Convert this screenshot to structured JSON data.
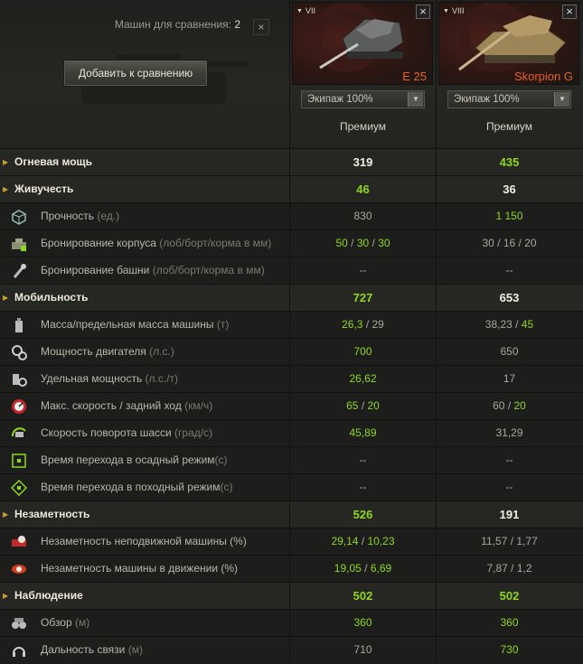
{
  "compare": {
    "label": "Машин для сравнения:",
    "count": "2",
    "close": "×",
    "add_button": "Добавить к сравнению"
  },
  "tanks": [
    {
      "tier": "VII",
      "name": "E 25",
      "crew": "Экипаж 100%",
      "type": "Премиум"
    },
    {
      "tier": "VIII",
      "name": "Skorpion G",
      "crew": "Экипаж 100%",
      "type": "Премиум"
    }
  ],
  "icons_close": "×",
  "colors": {
    "better": "#8fd81f",
    "neutral": "#a9a79b",
    "tank_name": "#e8602a"
  },
  "rows": [
    {
      "kind": "cat",
      "label": "Огневая мощь",
      "unit": "",
      "v1": [
        [
          "319",
          "w"
        ]
      ],
      "v2": [
        [
          "435",
          "g"
        ]
      ]
    },
    {
      "kind": "cat",
      "label": "Живучесть",
      "unit": "",
      "v1": [
        [
          "46",
          "g"
        ]
      ],
      "v2": [
        [
          "36",
          "w"
        ]
      ]
    },
    {
      "kind": "sub",
      "icon": "hitpoints-icon",
      "label": "Прочность",
      "unit": " (ед.)",
      "v1": [
        [
          "830",
          "n"
        ]
      ],
      "v2": [
        [
          "1 150",
          "g"
        ]
      ]
    },
    {
      "kind": "sub",
      "icon": "hull-armor-icon",
      "label": "Бронирование корпуса",
      "unit": " (лоб/борт/корма в мм)",
      "v1": [
        [
          "50",
          "g"
        ],
        [
          "30",
          "g"
        ],
        [
          "30",
          "g"
        ]
      ],
      "v2": [
        [
          "30",
          "n"
        ],
        [
          "16",
          "n"
        ],
        [
          "20",
          "n"
        ]
      ]
    },
    {
      "kind": "sub",
      "icon": "turret-armor-icon",
      "label": "Бронирование башни",
      "unit": " (лоб/борт/корма в мм)",
      "v1": [
        [
          "--",
          "n"
        ]
      ],
      "v2": [
        [
          "--",
          "n"
        ]
      ]
    },
    {
      "kind": "cat",
      "label": "Мобильность",
      "unit": "",
      "v1": [
        [
          "727",
          "g"
        ]
      ],
      "v2": [
        [
          "653",
          "w"
        ]
      ]
    },
    {
      "kind": "sub",
      "icon": "weight-icon",
      "label": "Масса/предельная масса машины",
      "unit": " (т)",
      "v1": [
        [
          "26,3",
          "g"
        ],
        [
          "29",
          "n"
        ]
      ],
      "v2": [
        [
          "38,23",
          "n"
        ],
        [
          "45",
          "g"
        ]
      ]
    },
    {
      "kind": "sub",
      "icon": "engine-power-icon",
      "label": "Мощность двигателя",
      "unit": " (л.с.)",
      "v1": [
        [
          "700",
          "g"
        ]
      ],
      "v2": [
        [
          "650",
          "n"
        ]
      ]
    },
    {
      "kind": "sub",
      "icon": "specific-power-icon",
      "label": "Удельная мощность",
      "unit": " (л.с./т)",
      "v1": [
        [
          "26,62",
          "g"
        ]
      ],
      "v2": [
        [
          "17",
          "n"
        ]
      ]
    },
    {
      "kind": "sub",
      "icon": "speed-icon",
      "label": "Макс. скорость / задний ход",
      "unit": " (км/ч)",
      "v1": [
        [
          "65",
          "g"
        ],
        [
          "20",
          "g"
        ]
      ],
      "v2": [
        [
          "60",
          "n"
        ],
        [
          "20",
          "g"
        ]
      ]
    },
    {
      "kind": "sub",
      "icon": "traverse-icon",
      "label": "Скорость поворота шасси",
      "unit": " (град/с)",
      "v1": [
        [
          "45,89",
          "g"
        ]
      ],
      "v2": [
        [
          "31,29",
          "n"
        ]
      ]
    },
    {
      "kind": "sub",
      "icon": "siege-mode-icon",
      "label": "Время перехода в осадный режим",
      "unit": "(с)",
      "v1": [
        [
          "--",
          "n"
        ]
      ],
      "v2": [
        [
          "--",
          "n"
        ]
      ]
    },
    {
      "kind": "sub",
      "icon": "travel-mode-icon",
      "label": "Время перехода в походный режим",
      "unit": "(с)",
      "v1": [
        [
          "--",
          "n"
        ]
      ],
      "v2": [
        [
          "--",
          "n"
        ]
      ]
    },
    {
      "kind": "cat",
      "label": "Незаметность",
      "unit": "",
      "v1": [
        [
          "526",
          "g"
        ]
      ],
      "v2": [
        [
          "191",
          "w"
        ]
      ]
    },
    {
      "kind": "sub",
      "icon": "camo-stationary-icon",
      "label": "Незаметность неподвижной машины (%)",
      "unit": "",
      "v1": [
        [
          "29,14",
          "g"
        ],
        [
          "10,23",
          "g"
        ]
      ],
      "v2": [
        [
          "11,57",
          "n"
        ],
        [
          "1,77",
          "n"
        ]
      ]
    },
    {
      "kind": "sub",
      "icon": "camo-moving-icon",
      "label": "Незаметность машины в движении (%)",
      "unit": "",
      "v1": [
        [
          "19,05",
          "g"
        ],
        [
          "6,69",
          "g"
        ]
      ],
      "v2": [
        [
          "7,87",
          "n"
        ],
        [
          "1,2",
          "n"
        ]
      ]
    },
    {
      "kind": "cat",
      "label": "Наблюдение",
      "unit": "",
      "v1": [
        [
          "502",
          "g"
        ]
      ],
      "v2": [
        [
          "502",
          "g"
        ]
      ]
    },
    {
      "kind": "sub",
      "icon": "view-range-icon",
      "label": "Обзор",
      "unit": " (м)",
      "v1": [
        [
          "360",
          "g"
        ]
      ],
      "v2": [
        [
          "360",
          "g"
        ]
      ]
    },
    {
      "kind": "sub",
      "icon": "radio-range-icon",
      "label": "Дальность связи",
      "unit": " (м)",
      "v1": [
        [
          "710",
          "n"
        ]
      ],
      "v2": [
        [
          "730",
          "g"
        ]
      ]
    }
  ]
}
